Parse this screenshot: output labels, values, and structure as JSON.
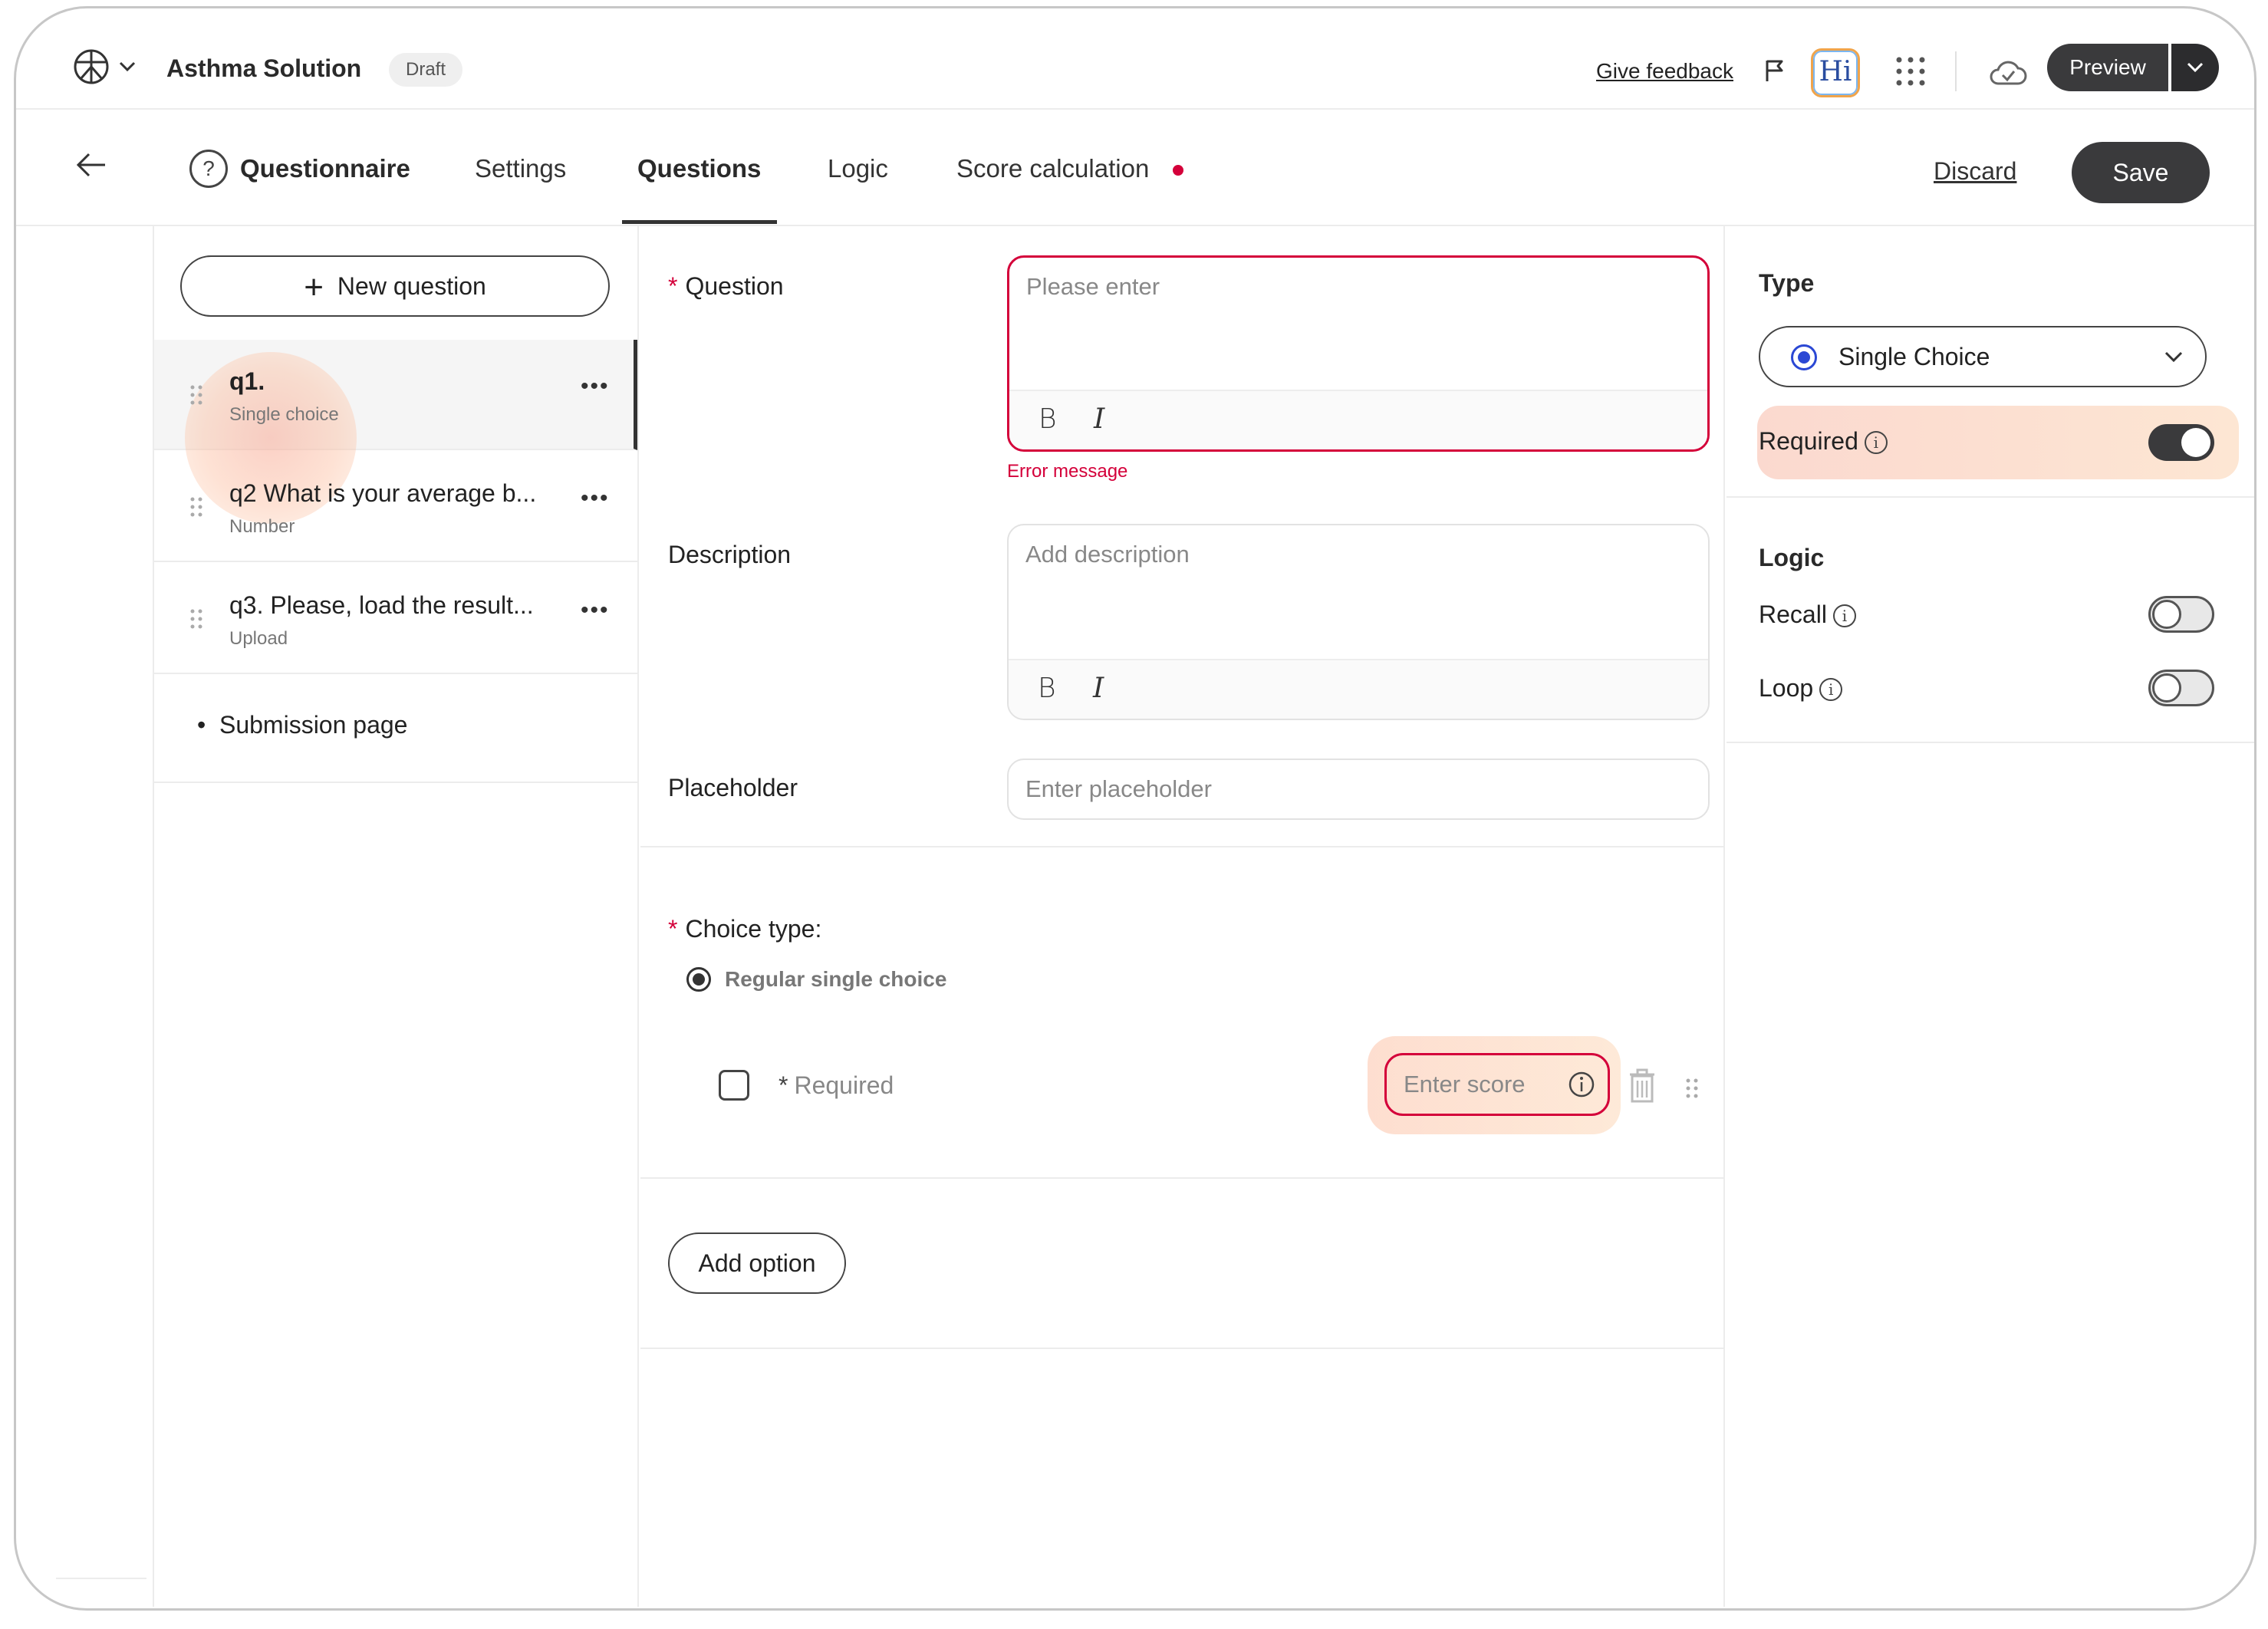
{
  "header": {
    "app_title": "Asthma Solution",
    "status_badge": "Draft",
    "feedback_link": "Give feedback",
    "hi_button": "Hi",
    "preview_label": "Preview"
  },
  "tabs": {
    "questionnaire": "Questionnaire",
    "settings": "Settings",
    "questions": "Questions",
    "logic": "Logic",
    "score_calculation": "Score calculation",
    "active": "Questions"
  },
  "actions": {
    "discard": "Discard",
    "save": "Save"
  },
  "question_list": {
    "new_question": "New question",
    "items": [
      {
        "title": "q1.",
        "type": "Single choice",
        "active": true
      },
      {
        "title": "q2 What is your average b...",
        "type": "Number",
        "active": false
      },
      {
        "title": "q3. Please, load the result...",
        "type": "Upload",
        "active": false
      }
    ],
    "submission_page": "Submission page"
  },
  "form": {
    "question_label": "Question",
    "question_placeholder": "Please enter",
    "error_message": "Error message",
    "description_label": "Description",
    "description_placeholder": "Add description",
    "placeholder_label": "Placeholder",
    "placeholder_placeholder": "Enter placeholder",
    "choice_type_label": "Choice type:",
    "choice_type_option": "Regular single choice",
    "option_label": "Required",
    "score_placeholder": "Enter score",
    "add_option": "Add option",
    "bold": "B",
    "italic": "I"
  },
  "properties": {
    "type_heading": "Type",
    "type_value": "Single Choice",
    "required_label": "Required",
    "required_on": true,
    "logic_heading": "Logic",
    "recall_label": "Recall",
    "recall_on": false,
    "loop_label": "Loop",
    "loop_on": false
  },
  "colors": {
    "primary_dark": "#3a3a3c",
    "error_red": "#d4003a",
    "radio_blue": "#2b48d4"
  }
}
